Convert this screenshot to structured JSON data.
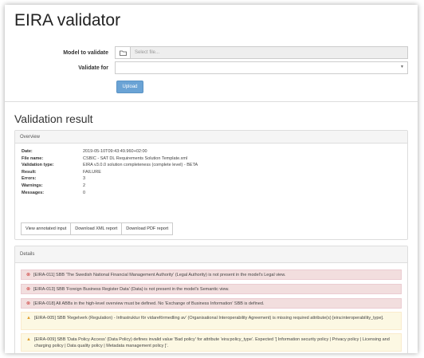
{
  "page": {
    "title": "EIRA validator"
  },
  "form": {
    "model_label": "Model to validate",
    "file_placeholder": "Select file...",
    "validate_for_label": "Validate for",
    "validate_for_value": "",
    "upload_label": "Upload"
  },
  "result": {
    "title": "Validation result",
    "overview": {
      "heading": "Overview",
      "rows": [
        {
          "key": "Date:",
          "value": "2019-05-10T09:43:49.960+02:00"
        },
        {
          "key": "File name:",
          "value": "CSBIC - SAT DL Requirements Solution Template.xml"
        },
        {
          "key": "Validation type:",
          "value": "EIRA v3.0.0 solution completeness (complete level) - BETA"
        },
        {
          "key": "Result:",
          "value": "FAILURE"
        },
        {
          "key": "Errors:",
          "value": "3"
        },
        {
          "key": "Warnings:",
          "value": "2"
        },
        {
          "key": "Messages:",
          "value": "0"
        }
      ],
      "buttons": [
        "View annotated input",
        "Download XML report",
        "Download PDF report"
      ]
    },
    "details": {
      "heading": "Details",
      "errors": [
        "[EIRA-011] SBB 'The Swedish National Financial Management Authority' (Legal Authority) is not present in the model's Legal view.",
        "[EIRA-013] SBB 'Foreign Business Register Data' (Data) is not present in the model's Semantic view.",
        "[EIRA-018] All ABBs in the high-level overview must be defined. No 'Exchange of Business Information' SBB is defined."
      ],
      "warnings": [
        "[EIRA-005] SBB 'Regelverk (Regulation) - Infrastruktur för vidareförmedling av' (Organisational Interoperability Agreement) is missing required attribute(s) [eira:interoperability_type].",
        "[EIRA-009] SBB 'Data Policy Access' (Data Policy) defines invalid value 'Bad policy' for attribute 'eira:policy_type'. Expected '[ Information security policy | Privacy policy | Licensing and charging policy | Data quality policy | Metadata management policy ]'."
      ]
    }
  },
  "colors": {
    "primary": "#6aa3d5",
    "danger_bg": "#f2dede",
    "warning_bg": "#fcf8e3"
  }
}
